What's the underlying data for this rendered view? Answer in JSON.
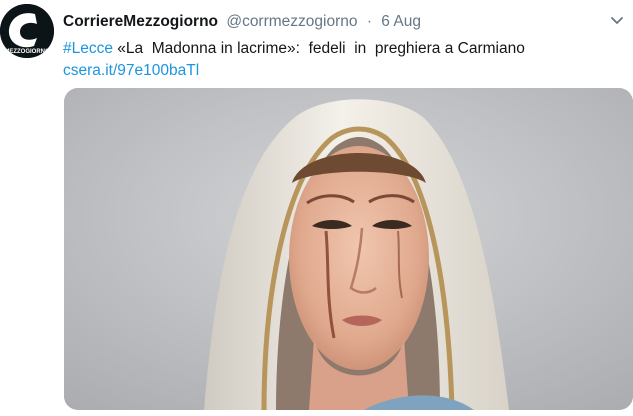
{
  "tweet": {
    "avatar_label": "MEZZOGIORNO",
    "display_name": "CorriereMezzogiorno",
    "handle": "@corrmezzogiorno",
    "separator": "·",
    "date": "6 Aug",
    "hashtag": "#Lecce",
    "body": " «La  Madonna in lacrime»:  fedeli  in  preghiera a Carmiano",
    "link": "csera.it/97e100baTl",
    "colors": {
      "accent": "#1b95e0",
      "name": "#14171a",
      "muted": "#657786"
    },
    "media": {
      "icon": "photo-statue-madonna"
    },
    "menu_icon": "chevron-down-icon"
  }
}
